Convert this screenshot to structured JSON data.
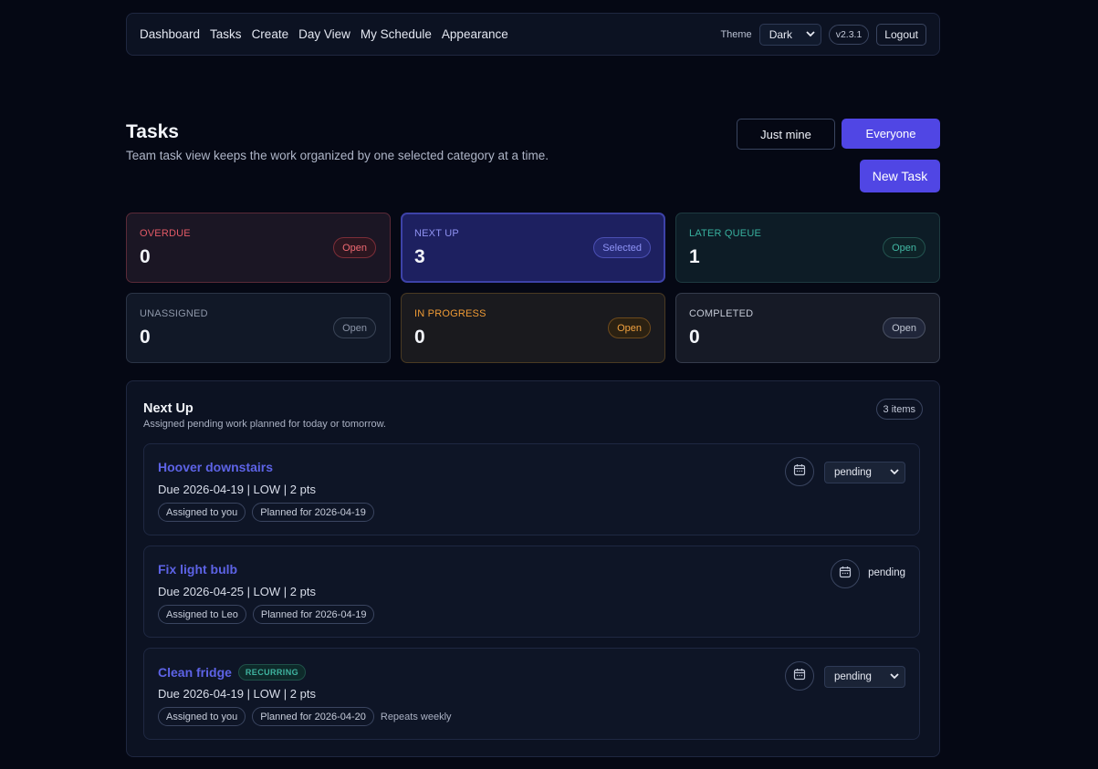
{
  "nav": {
    "links": [
      "Dashboard",
      "Tasks",
      "Create",
      "Day View",
      "My Schedule",
      "Appearance"
    ],
    "theme_label": "Theme",
    "theme_value": "Dark",
    "version": "v2.3.1",
    "logout": "Logout"
  },
  "header": {
    "title": "Tasks",
    "subtitle": "Team task view keeps the work organized by one selected category at a time.",
    "just_mine": "Just mine",
    "everyone": "Everyone",
    "new_task": "New Task"
  },
  "categories": [
    {
      "label": "OVERDUE",
      "count": "0",
      "badge": "Open"
    },
    {
      "label": "NEXT UP",
      "count": "3",
      "badge": "Selected"
    },
    {
      "label": "LATER QUEUE",
      "count": "1",
      "badge": "Open"
    },
    {
      "label": "UNASSIGNED",
      "count": "0",
      "badge": "Open"
    },
    {
      "label": "IN PROGRESS",
      "count": "0",
      "badge": "Open"
    },
    {
      "label": "COMPLETED",
      "count": "0",
      "badge": "Open"
    }
  ],
  "panel": {
    "title": "Next Up",
    "subtitle": "Assigned pending work planned for today or tomorrow.",
    "count": "3 items"
  },
  "tasks": [
    {
      "name": "Hoover downstairs",
      "meta": "Due 2026-04-19 | LOW | 2 pts",
      "assigned": "Assigned to you",
      "planned": "Planned for 2026-04-19",
      "status": "pending"
    },
    {
      "name": "Fix light bulb",
      "meta": "Due 2026-04-25 | LOW | 2 pts",
      "assigned": "Assigned to Leo",
      "planned": "Planned for 2026-04-19",
      "status": "pending"
    },
    {
      "name": "Clean fridge",
      "tag": "RECURRING",
      "meta": "Due 2026-04-19 | LOW | 2 pts",
      "assigned": "Assigned to you",
      "planned": "Planned for 2026-04-20",
      "repeat": "Repeats weekly",
      "status": "pending"
    }
  ]
}
